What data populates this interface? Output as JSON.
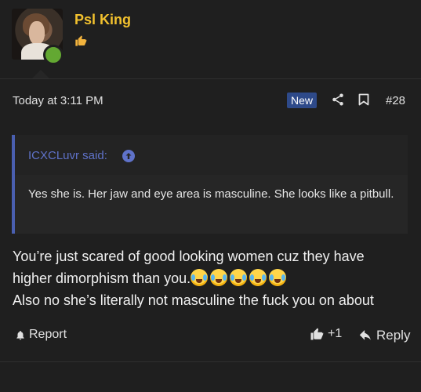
{
  "user": {
    "name": "Psl King",
    "badge_icon": "thumbs-up-icon",
    "online": true
  },
  "meta": {
    "timestamp": "Today at 3:11 PM",
    "new_label": "New",
    "post_number": "#28"
  },
  "quote": {
    "author": "ICXCLuvr said:",
    "text": "Yes she is. Her jaw and eye area is masculine. She looks like a pitbull."
  },
  "post": {
    "line1": "You’re just scared of good looking women cuz they have",
    "line2": "higher dimorphism than you.",
    "emoji_count": 5,
    "line3": "Also no she’s literally not masculine the fuck you on about"
  },
  "actions": {
    "report_label": "Report",
    "like_label": "+1",
    "reply_label": "Reply"
  },
  "colors": {
    "background": "#1f1f1f",
    "username": "#f2c12e",
    "quote_accent": "#4a5fb0",
    "new_badge": "#2e4a8a",
    "online": "#63a832"
  }
}
